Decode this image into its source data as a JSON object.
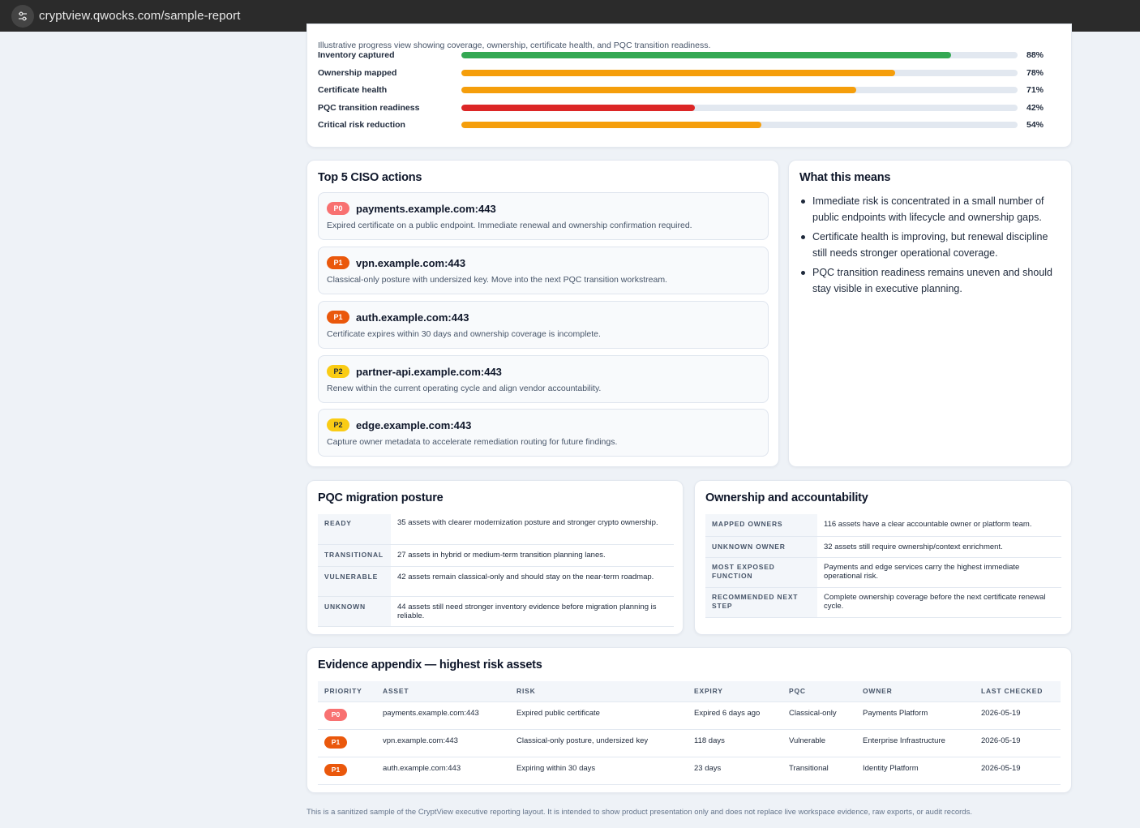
{
  "browser": {
    "url": "cryptview.qwocks.com/sample-report"
  },
  "progress": {
    "description": "Illustrative progress view showing coverage, ownership, certificate health, and PQC transition readiness.",
    "rows": [
      {
        "label": "Inventory captured",
        "value": 88,
        "display": "88%",
        "color": "#34a853"
      },
      {
        "label": "Ownership mapped",
        "value": 78,
        "display": "78%",
        "color": "#f59e0b"
      },
      {
        "label": "Certificate health",
        "value": 71,
        "display": "71%",
        "color": "#f59e0b"
      },
      {
        "label": "PQC transition readiness",
        "value": 42,
        "display": "42%",
        "color": "#dc2626"
      },
      {
        "label": "Critical risk reduction",
        "value": 54,
        "display": "54%",
        "color": "#f59e0b"
      }
    ]
  },
  "actions": {
    "title": "Top 5 CISO actions",
    "items": [
      {
        "priority": "P0",
        "title": "payments.example.com:443",
        "desc": "Expired certificate on a public endpoint. Immediate renewal and ownership confirmation required."
      },
      {
        "priority": "P1",
        "title": "vpn.example.com:443",
        "desc": "Classical-only posture with undersized key. Move into the next PQC transition workstream."
      },
      {
        "priority": "P1",
        "title": "auth.example.com:443",
        "desc": "Certificate expires within 30 days and ownership coverage is incomplete."
      },
      {
        "priority": "P2",
        "title": "partner-api.example.com:443",
        "desc": "Renew within the current operating cycle and align vendor accountability."
      },
      {
        "priority": "P2",
        "title": "edge.example.com:443",
        "desc": "Capture owner metadata to accelerate remediation routing for future findings."
      }
    ]
  },
  "means": {
    "title": "What this means",
    "items": [
      "Immediate risk is concentrated in a small number of public endpoints with lifecycle and ownership gaps.",
      "Certificate health is improving, but renewal discipline still needs stronger operational coverage.",
      "PQC transition readiness remains uneven and should stay visible in executive planning."
    ]
  },
  "pqc": {
    "title": "PQC migration posture",
    "rows": [
      {
        "key": "READY",
        "value": "35 assets with clearer modernization posture and stronger crypto ownership."
      },
      {
        "key": "TRANSITIONAL",
        "value": "27 assets in hybrid or medium-term transition planning lanes."
      },
      {
        "key": "VULNERABLE",
        "value": "42 assets remain classical-only and should stay on the near-term roadmap."
      },
      {
        "key": "UNKNOWN",
        "value": "44 assets still need stronger inventory evidence before migration planning is reliable."
      }
    ]
  },
  "ownership": {
    "title": "Ownership and accountability",
    "rows": [
      {
        "key": "MAPPED OWNERS",
        "value": "116 assets have a clear accountable owner or platform team."
      },
      {
        "key": "UNKNOWN OWNER",
        "value": "32 assets still require ownership/context enrichment."
      },
      {
        "key": "MOST EXPOSED FUNCTION",
        "value": "Payments and edge services carry the highest immediate operational risk."
      },
      {
        "key": "RECOMMENDED NEXT STEP",
        "value": "Complete ownership coverage before the next certificate renewal cycle."
      }
    ]
  },
  "evidence": {
    "title": "Evidence appendix — highest risk assets",
    "headers": [
      "PRIORITY",
      "ASSET",
      "RISK",
      "EXPIRY",
      "PQC",
      "OWNER",
      "LAST CHECKED"
    ],
    "rows": [
      {
        "priority": "P0",
        "asset": "payments.example.com:443",
        "risk": "Expired public certificate",
        "expiry": "Expired 6 days ago",
        "pqc": "Classical-only",
        "owner": "Payments Platform",
        "checked": "2026-05-19"
      },
      {
        "priority": "P1",
        "asset": "vpn.example.com:443",
        "risk": "Classical-only posture, undersized key",
        "expiry": "118 days",
        "pqc": "Vulnerable",
        "owner": "Enterprise Infrastructure",
        "checked": "2026-05-19"
      },
      {
        "priority": "P1",
        "asset": "auth.example.com:443",
        "risk": "Expiring within 30 days",
        "expiry": "23 days",
        "pqc": "Transitional",
        "owner": "Identity Platform",
        "checked": "2026-05-19"
      }
    ]
  },
  "footer": "This is a sanitized sample of the CryptView executive reporting layout. It is intended to show product presentation only and does not replace live workspace evidence, raw exports, or audit records."
}
